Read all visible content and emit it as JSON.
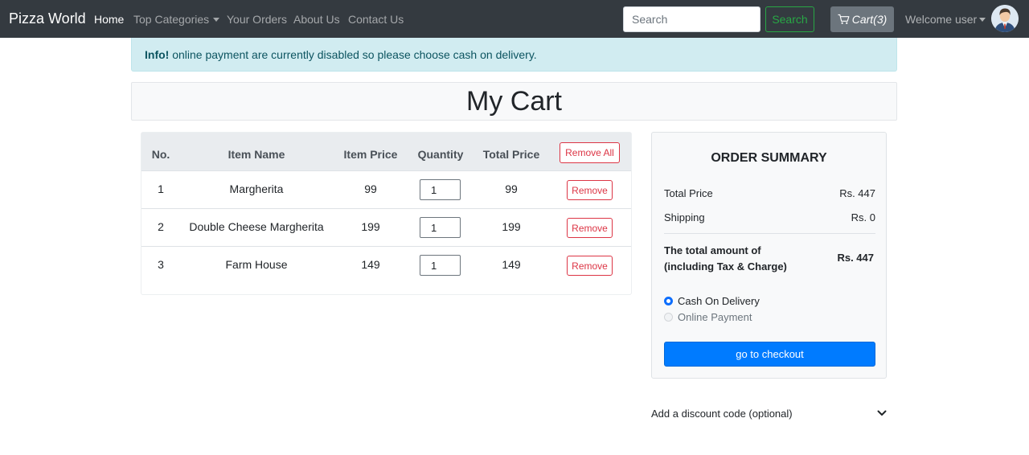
{
  "navbar": {
    "brand": "Pizza World",
    "links": [
      {
        "label": "Home",
        "active": true
      },
      {
        "label": "Top Categories",
        "dropdown": true
      },
      {
        "label": "Your Orders"
      },
      {
        "label": "About Us"
      },
      {
        "label": "Contact Us"
      }
    ],
    "search_placeholder": "Search",
    "search_button": "Search",
    "cart_label": "Cart(3)",
    "welcome": "Welcome user"
  },
  "alert": {
    "strong": "Info!",
    "text": " online payment are currently disabled so please choose cash on delivery."
  },
  "page_title": "My Cart",
  "table": {
    "headers": [
      "No.",
      "Item Name",
      "Item Price",
      "Quantity",
      "Total Price"
    ],
    "remove_all": "Remove All",
    "rows": [
      {
        "no": "1",
        "name": "Margherita",
        "price": "99",
        "qty": "1",
        "total": "99",
        "remove": "Remove"
      },
      {
        "no": "2",
        "name": "Double Cheese Margherita",
        "price": "199",
        "qty": "1",
        "total": "199",
        "remove": "Remove"
      },
      {
        "no": "3",
        "name": "Farm House",
        "price": "149",
        "qty": "1",
        "total": "149",
        "remove": "Remove"
      }
    ]
  },
  "summary": {
    "title": "ORDER SUMMARY",
    "total_price_label": "Total Price",
    "total_price_value": "Rs. 447",
    "shipping_label": "Shipping",
    "shipping_value": "Rs. 0",
    "total_amount_label_1": "The total amount of",
    "total_amount_label_2": "(including Tax & Charge)",
    "total_amount_value": "Rs. 447",
    "payment_options": [
      {
        "label": "Cash On Delivery",
        "checked": true,
        "disabled": false
      },
      {
        "label": "Online Payment",
        "checked": false,
        "disabled": true
      }
    ],
    "checkout_button": "go to checkout"
  },
  "discount": {
    "label": "Add a discount code (optional)"
  },
  "colors": {
    "navbar_bg": "#343a40",
    "alert_bg": "#d1ecf1",
    "primary": "#007bff",
    "danger": "#dc3545",
    "success": "#28a745"
  }
}
